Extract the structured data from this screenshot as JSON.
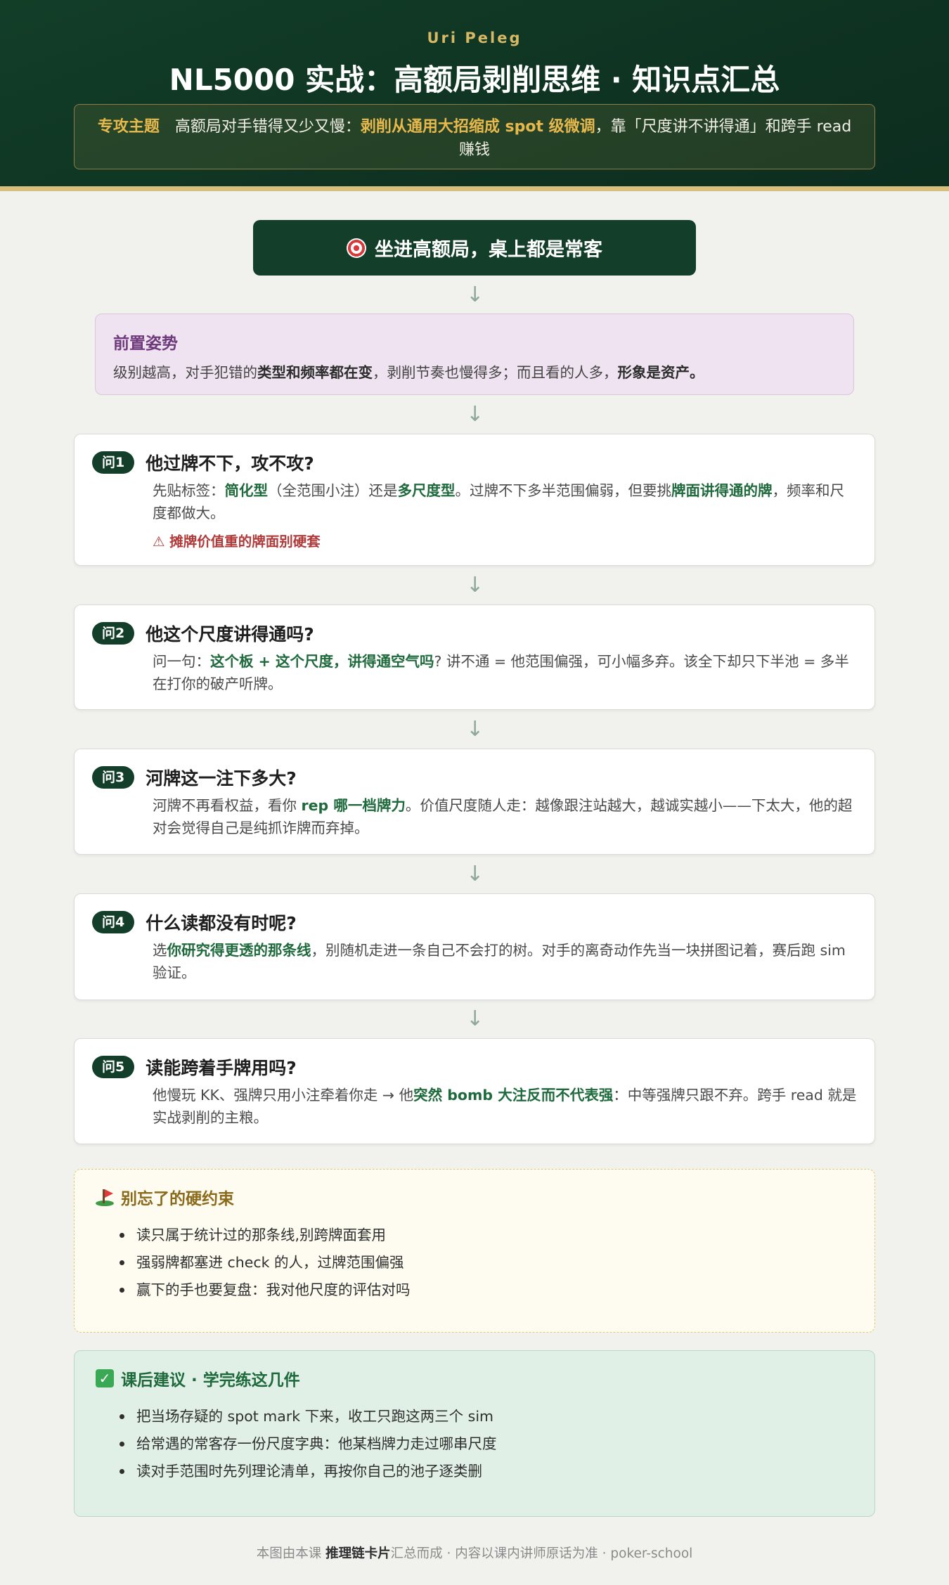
{
  "header": {
    "author": "Uri Peleg",
    "title": "NL5000 实战：高额局剥削思维 · 知识点汇总",
    "topic_label": "专攻主题",
    "topic_text_1": "高额局对手错得又少又慢：",
    "topic_highlight": "剥削从通用大招缩成 spot 级微调",
    "topic_text_2": "，靠「尺度讲不讲得通」和跨手 read 赚钱"
  },
  "start": {
    "label": "坐进高额局，桌上都是常客",
    "icon": "target-icon"
  },
  "precondition": {
    "title": "前置姿势",
    "t1": "级别越高，对手犯错的",
    "b1": "类型和频率都在变",
    "t2": "，剥削节奏也慢得多；而且看的人多，",
    "b2": "形象是资产。"
  },
  "questions": [
    {
      "pill": "问1",
      "title": "他过牌不下，攻不攻?",
      "t1": "先贴标签：",
      "g1": "简化型",
      "t2": "（全范围小注）还是",
      "g2": "多尺度型",
      "t3": "。过牌不下多半范围偏弱，但要挑",
      "g3": "牌面讲得通的牌",
      "t4": "，频率和尺度都做大。",
      "warn": "⚠ 摊牌价值重的牌面别硬套"
    },
    {
      "pill": "问2",
      "title": "他这个尺度讲得通吗?",
      "t1": "问一句：",
      "g1": "这个板 + 这个尺度，讲得通空气吗",
      "t2": "? 讲不通 = 他范围偏强，可小幅多弃。该全下却只下半池 = 多半在打你的破产听牌。"
    },
    {
      "pill": "问3",
      "title": "河牌这一注下多大?",
      "t1": "河牌不再看权益，看你 ",
      "g1": "rep 哪一档牌力",
      "t2": "。价值尺度随人走：越像跟注站越大，越诚实越小——下太大，他的超对会觉得自己是纯抓诈牌而弃掉。"
    },
    {
      "pill": "问4",
      "title": "什么读都没有时呢?",
      "t1": "选",
      "g1": "你研究得更透的那条线",
      "t2": "，别随机走进一条自己不会打的树。对手的离奇动作先当一块拼图记着，赛后跑 sim 验证。"
    },
    {
      "pill": "问5",
      "title": "读能跨着手牌用吗?",
      "t1": "他慢玩 KK、强牌只用小注牵着你走 → 他",
      "g1": "突然 bomb 大注反而不代表强",
      "t2": "：中等强牌只跟不弃。跨手 read 就是实战剥削的主粮。"
    }
  ],
  "constraints": {
    "title": "别忘了的硬约束",
    "icon": "golf-flag-icon",
    "items": [
      "读只属于统计过的那条线,别跨牌面套用",
      "强弱牌都塞进 check 的人，过牌范围偏强",
      "赢下的手也要复盘：我对他尺度的评估对吗"
    ]
  },
  "homework": {
    "title": "课后建议 · 学完练这几件",
    "icon": "check-icon",
    "check_glyph": "✓",
    "items": [
      "把当场存疑的 spot mark 下来，收工只跑这两三个 sim",
      "给常遇的常客存一份尺度字典：他某档牌力走过哪串尺度",
      "读对手范围时先列理论清单，再按你自己的池子逐类删"
    ]
  },
  "footer": {
    "t1": "本图由本课 ",
    "b1": "推理链卡片",
    "t2": "汇总而成 · 内容以课内讲师原话为准 · poker-school"
  },
  "arrow_glyph": "↓"
}
